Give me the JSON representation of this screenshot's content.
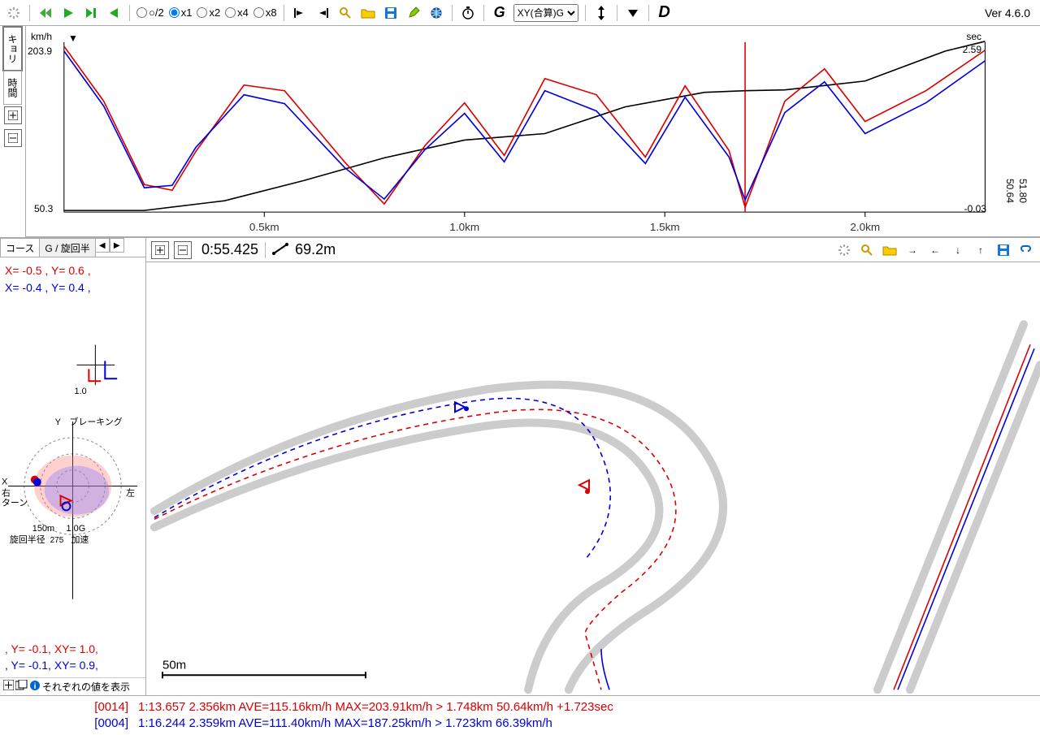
{
  "app": {
    "version": "Ver 4.6.0"
  },
  "toolbar": {
    "zoom_circle": "○/2",
    "speed": {
      "x1": "x1",
      "x2": "x2",
      "x4": "x4",
      "x8": "x8",
      "selected": "x1"
    },
    "xy_select": [
      "XY(合算)G"
    ],
    "g_button": "G",
    "d_button": "D"
  },
  "chart": {
    "y_label_left": "km/h",
    "y_max": "203.9",
    "y_min": "50.3",
    "y_label_right_top": "sec",
    "y_right_top_val": "2.59",
    "y_right_bottom_val": "-0.03",
    "far_right_top": "50.64",
    "far_right_bottom": "51.80",
    "side_tabs": {
      "kyori": "キョリ",
      "jikan": "時間"
    },
    "x_ticks": [
      "0.5km",
      "1.0km",
      "1.5km",
      "2.0km"
    ]
  },
  "lpanel": {
    "tabs": {
      "course": "コース",
      "g": "G / 旋回半"
    },
    "readout1_red": "X= -0.5 , Y=  0.6 ,",
    "readout1_blue": "X= -0.4 , Y=  0.4 ,",
    "axis_top_val": "1.0",
    "labels": {
      "y": "Y",
      "braking": "ブレーキング",
      "x": "X",
      "right_turn": "右\nターン",
      "left": "左",
      "turn_radius": "旋回半径",
      "accel": "加速",
      "g_scale": "1.0G",
      "r_scale": "150m",
      "r275": "275"
    },
    "readout2_red": ", Y= -0.1, XY= 1.0,",
    "readout2_blue": ", Y= -0.1, XY= 0.9,",
    "foot_text": "それぞれの値を表示"
  },
  "map_toolbar": {
    "time": "0:55.425",
    "distance": "69.2m"
  },
  "map": {
    "scale_label": "50m"
  },
  "status": {
    "row1_tag": "[0014]",
    "row1_text": "1:13.657 2.356km AVE=115.16km/h MAX=203.91km/h > 1.748km 50.64km/h +1.723sec",
    "row2_tag": "[0004]",
    "row2_text": "1:16.244 2.359km AVE=111.40km/h MAX=187.25km/h > 1.723km 66.39km/h"
  },
  "chart_data": {
    "type": "line",
    "xlabel": "distance (km)",
    "ylabel": "km/h",
    "xlim": [
      0,
      2.3
    ],
    "ylim_left": [
      50.3,
      203.9
    ],
    "ylim_right_sec": [
      -0.03,
      2.59
    ],
    "x_ticks": [
      0.5,
      1.0,
      1.5,
      2.0
    ],
    "series": [
      {
        "name": "lap_0014_speed",
        "color": "#d00",
        "x": [
          0.0,
          0.1,
          0.2,
          0.27,
          0.33,
          0.45,
          0.55,
          0.7,
          0.8,
          0.9,
          1.0,
          1.1,
          1.2,
          1.33,
          1.45,
          1.55,
          1.66,
          1.7,
          1.8,
          1.9,
          2.0,
          2.15,
          2.3
        ],
        "y": [
          200,
          150,
          75,
          70,
          105,
          165,
          160,
          95,
          60,
          110,
          150,
          100,
          170,
          155,
          100,
          165,
          105,
          52,
          150,
          180,
          130,
          160,
          198
        ]
      },
      {
        "name": "lap_0004_speed",
        "color": "#00d",
        "x": [
          0.0,
          0.1,
          0.2,
          0.27,
          0.33,
          0.45,
          0.55,
          0.7,
          0.8,
          0.9,
          1.0,
          1.1,
          1.2,
          1.33,
          1.45,
          1.55,
          1.66,
          1.7,
          1.8,
          1.9,
          2.0,
          2.15,
          2.3
        ],
        "y": [
          195,
          145,
          72,
          75,
          110,
          155,
          150,
          90,
          65,
          105,
          140,
          95,
          160,
          140,
          95,
          155,
          100,
          60,
          140,
          170,
          120,
          150,
          185
        ]
      },
      {
        "name": "time_gap_sec",
        "color": "#000",
        "axis": "right",
        "x": [
          0.0,
          0.2,
          0.4,
          0.6,
          0.8,
          1.0,
          1.2,
          1.4,
          1.6,
          1.7,
          1.8,
          2.0,
          2.2,
          2.3
        ],
        "y": [
          -0.02,
          -0.02,
          0.15,
          0.45,
          0.8,
          1.05,
          1.15,
          1.55,
          1.78,
          1.8,
          1.82,
          1.95,
          2.4,
          2.55
        ]
      }
    ],
    "cursor_x": 1.7
  }
}
